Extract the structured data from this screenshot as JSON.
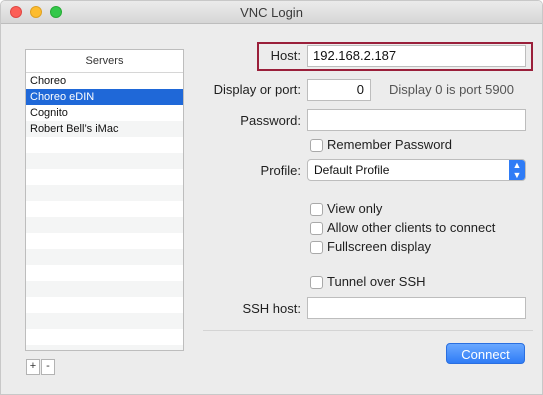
{
  "window": {
    "title": "VNC Login"
  },
  "servers": {
    "header": "Servers",
    "items": [
      "Choreo",
      "Choreo eDIN",
      "Cognito",
      "Robert Bell’s iMac"
    ],
    "selected_index": 1,
    "add_label": "+",
    "remove_label": "-"
  },
  "form": {
    "host_label": "Host:",
    "host_value": "192.168.2.187",
    "display_label": "Display or port:",
    "display_value": "0",
    "display_note": "Display 0 is port 5900",
    "password_label": "Password:",
    "password_value": "",
    "remember_password": {
      "label": "Remember Password",
      "checked": false
    },
    "profile_label": "Profile:",
    "profile_value": "Default Profile",
    "options": [
      {
        "label": "View only",
        "checked": false
      },
      {
        "label": "Allow other clients to connect",
        "checked": false
      },
      {
        "label": "Fullscreen display",
        "checked": false
      }
    ],
    "tunnel_ssh": {
      "label": "Tunnel over SSH",
      "checked": false
    },
    "ssh_host_label": "SSH host:",
    "ssh_host_value": ""
  },
  "buttons": {
    "connect_label": "Connect"
  },
  "colors": {
    "accent": "#2f7cf6",
    "selection": "#1f68d8",
    "highlight_box": "#9a1f3a"
  }
}
